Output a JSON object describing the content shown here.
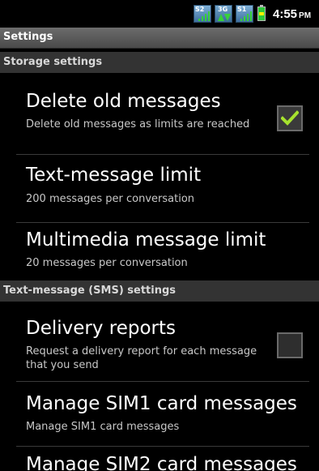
{
  "status_bar": {
    "sim1_label": "S2",
    "data_label": "3G",
    "sim2_label": "S1",
    "time": "4:55",
    "ampm": "PM",
    "icons": [
      "sim-signal-icon",
      "data-3g-icon",
      "sim-signal-icon",
      "battery-icon"
    ]
  },
  "title": "Settings",
  "sections": {
    "storage": "Storage settings",
    "sms": "Text-message (SMS) settings"
  },
  "prefs": {
    "delete_old": {
      "title": "Delete old messages",
      "summary": "Delete old messages as limits are reached",
      "checked": true
    },
    "text_limit": {
      "title": "Text-message limit",
      "summary": "200 messages per conversation"
    },
    "mms_limit": {
      "title": "Multimedia message limit",
      "summary": "20 messages per conversation"
    },
    "delivery_reports": {
      "title": "Delivery reports",
      "summary": "Request a delivery report for each message that you send",
      "checked": false
    },
    "manage_sim1": {
      "title": "Manage SIM1 card messages",
      "summary": "Manage SIM1 card messages"
    },
    "manage_sim2": {
      "title": "Manage SIM2 card messages"
    }
  },
  "colors": {
    "background": "#000000",
    "section_header": "#333333",
    "check_mark": "#a6e22e",
    "signal_green": "#37d13a"
  }
}
